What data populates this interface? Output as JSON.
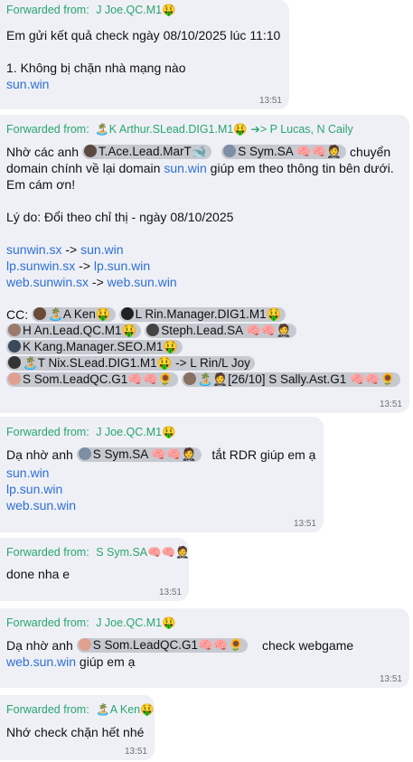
{
  "labels": {
    "forwarded_from": "Forwarded from:"
  },
  "messages": [
    {
      "sender": "J Joe.QC.M1🤑",
      "line1": "Em gửi kết quả check ngày 08/10/2025 lúc 11:10",
      "line2": "1. Không bị chặn nhà mạng nào",
      "link1": "sun.win",
      "time": "13:51"
    },
    {
      "sender": "🏝️K Arthur.SLead.DIG1.M1🤑 ➔> P Lucas, N Caily",
      "intro": "Nhờ các anh",
      "mention1": "T.Ace.Lead.MarT🐋",
      "mention2": "S Sym.SA 🧠🧠🤵",
      "intro_end": "chuyển",
      "line2_pre": "domain chính về lại domain ",
      "line2_link": "sun.win",
      "line2_post": " giúp em theo thông tin bên dưới.",
      "line3": "Em cám ơn!",
      "reason": "Lý do: Đổi theo chỉ thị - ngày 08/10/2025",
      "redirects": [
        {
          "from": "sunwin.sx",
          "arrow": " -> ",
          "to": "sun.win"
        },
        {
          "from": "lp.sunwin.sx",
          "arrow": " -> ",
          "to": "lp.sun.win"
        },
        {
          "from": "web.sunwin.sx",
          "arrow": " -> ",
          "to": "web.sun.win"
        }
      ],
      "cc_label": "CC:",
      "cc": [
        "🏝️A Ken🤑",
        "L Rin.Manager.DIG1.M1🤑",
        "H An.Lead.QC.M1🤑",
        "Steph.Lead.SA 🧠🧠🤵",
        "K Kang.Manager.SEO.M1🤑",
        "🏝️T Nix.SLead.DIG1.M1🤑 -> L Rin/L Joy",
        "S Som.LeadQC.G1🧠🧠🌻",
        "🏝️🤵[26/10] S Sally.Ast.G1 🧠🧠🌻"
      ],
      "time": "13:51"
    },
    {
      "sender": "J Joe.QC.M1🤑",
      "pre": "Dạ nhờ anh",
      "mention": "S Sym.SA 🧠🧠🤵",
      "post": "tắt RDR giúp em ạ",
      "links": [
        "sun.win",
        "lp.sun.win",
        "web.sun.win"
      ],
      "time": "13:51"
    },
    {
      "sender": "S Sym.SA🧠🧠🤵",
      "text": "done nha e",
      "time": "13:51"
    },
    {
      "sender": "J Joe.QC.M1🤑",
      "pre": "Dạ nhờ anh",
      "mention": "S Som.LeadQC.G1🧠🧠🌻",
      "post": "check webgame",
      "link": "web.sun.win",
      "link_post": " giúp em ạ",
      "time": "13:51"
    },
    {
      "sender": "🏝️A Ken🤑",
      "text": "Nhớ check chặn hết nhé",
      "time": "13:51"
    }
  ],
  "colors": {
    "bubble": "#eef0f6",
    "sender": "#2aa56e",
    "link": "#2f6fd6",
    "chip": "#c6c9d0"
  }
}
